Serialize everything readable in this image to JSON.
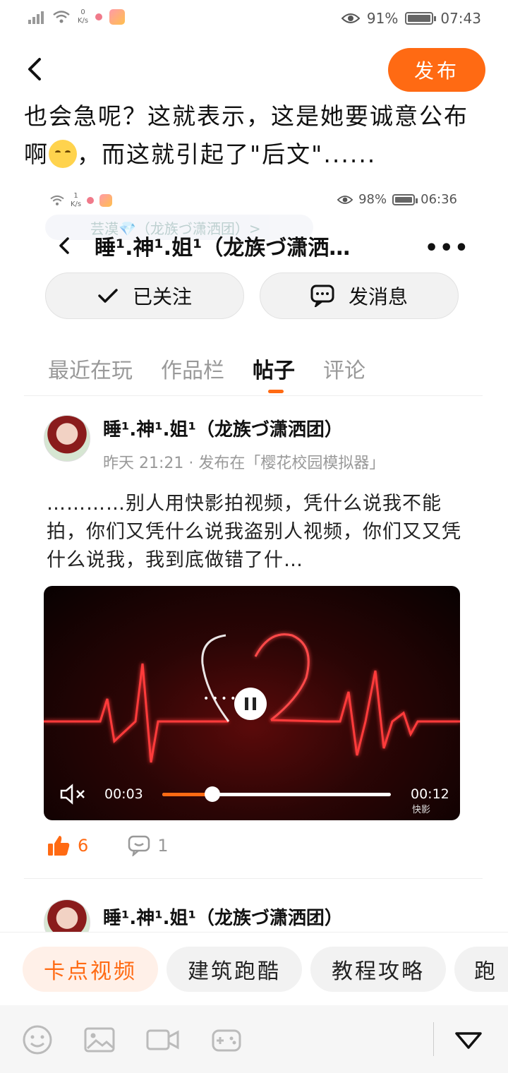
{
  "status_bar": {
    "speed_value": "0",
    "speed_unit": "K/s",
    "battery_percent": "91%",
    "time": "07:43"
  },
  "header": {
    "publish_label": "发布"
  },
  "intro": {
    "line1": "也会急呢？这就表示，这是她要诚意公布",
    "line2_prefix": "啊",
    "line2_suffix": "，而这就引起了\"后文\"......"
  },
  "embedded_screenshot": {
    "status": {
      "speed_value": "1",
      "speed_unit": "K/s",
      "battery_percent": "98%",
      "time": "06:36"
    },
    "faded_label": "芸漠💎（龙族づ潇洒团）>",
    "profile_title": "睡¹.神¹.姐¹（龙族づ潇洒…",
    "follow_label": "已关注",
    "message_label": "发消息",
    "tabs": [
      {
        "label": "最近在玩",
        "active": false
      },
      {
        "label": "作品栏",
        "active": false
      },
      {
        "label": "帖子",
        "active": true
      },
      {
        "label": "评论",
        "active": false
      }
    ],
    "post": {
      "author": "睡¹.神¹.姐¹（龙族づ潇洒团）",
      "meta": "昨天 21:21 · 发布在「樱花校园模拟器」",
      "content": "…………别人用快影拍视频，凭什么说我不能拍，你们又凭什么说我盗别人视频，你们又又凭什么说我，我到底做错了什…",
      "video": {
        "current_time": "00:03",
        "total_time": "00:12",
        "progress": 0.22,
        "brand": "快影"
      },
      "likes": "6",
      "comments": "1"
    },
    "post2": {
      "author": "睡¹.神¹.姐¹（龙族づ潇洒团）"
    }
  },
  "topics": [
    {
      "label": "卡点视频",
      "selected": true
    },
    {
      "label": "建筑跑酷",
      "selected": false
    },
    {
      "label": "教程攻略",
      "selected": false
    },
    {
      "label": "跑",
      "selected": false
    }
  ],
  "colors": {
    "accent": "#ff6a13",
    "chip_selected_bg": "#fff0e8"
  }
}
